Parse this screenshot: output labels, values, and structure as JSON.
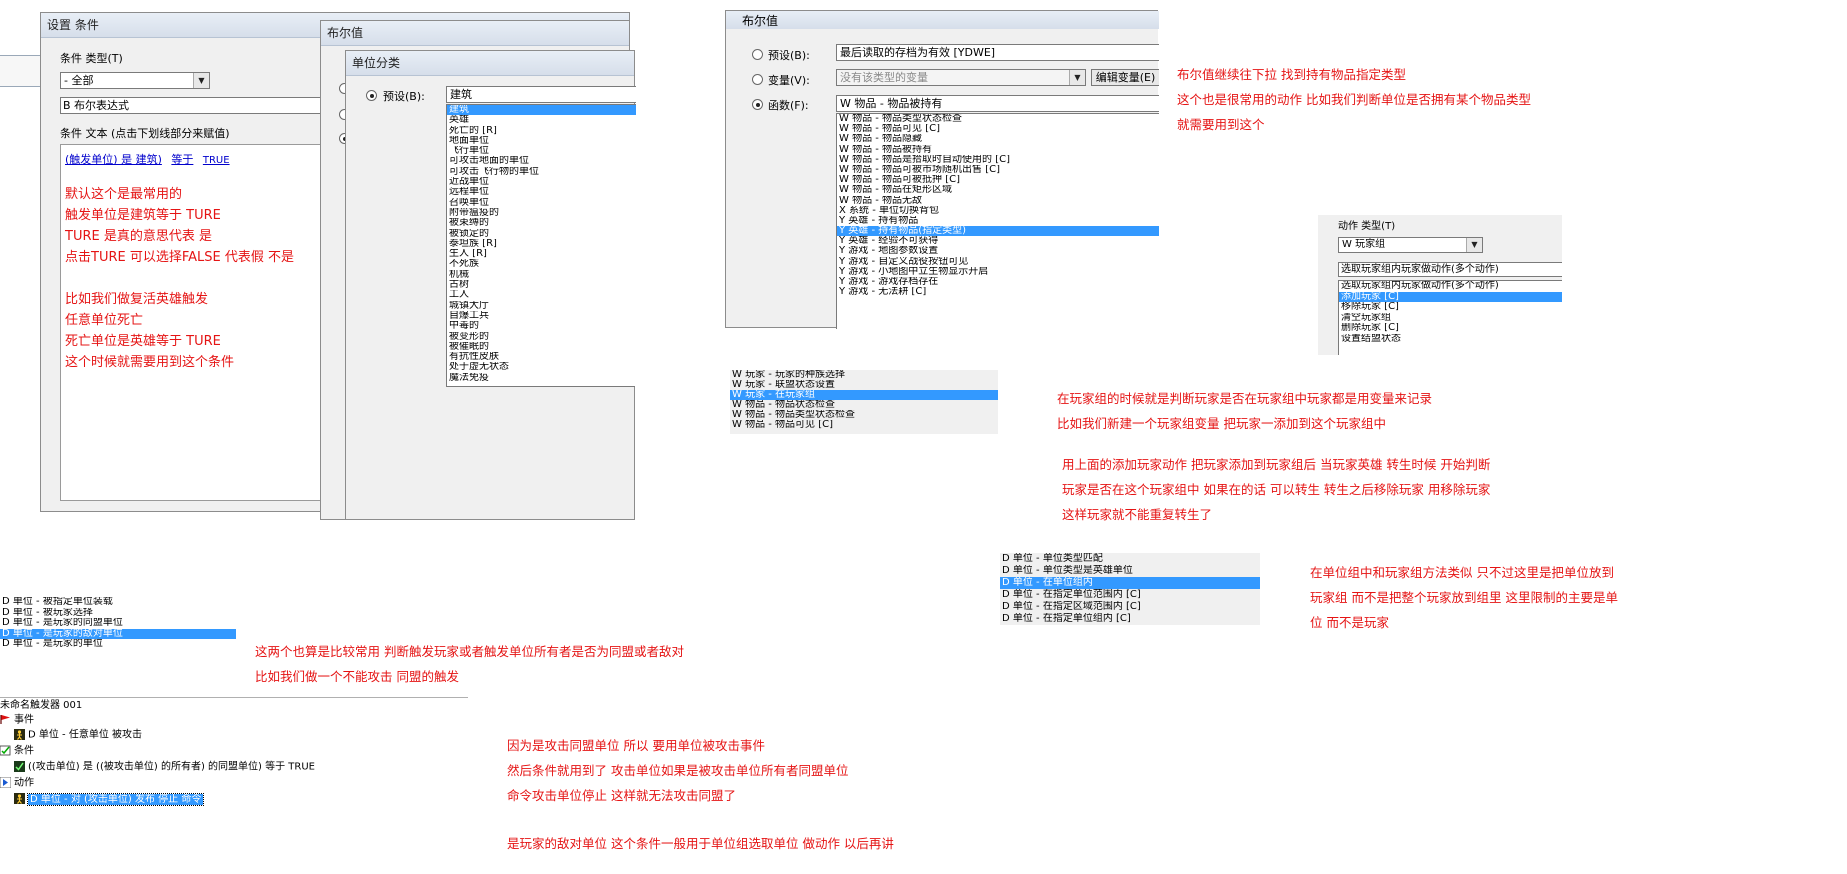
{
  "condition_dialog": {
    "title": "设置 条件",
    "type_label": "条件 类型(T)",
    "type_value": "- 全部",
    "selected_item": "B 布尔表达式",
    "text_label": "条件 文本 (点击下划线部分来赋值)",
    "expr_part1": "(触发单位) 是 建筑)",
    "expr_part2": "等于",
    "expr_part3": "TRUE"
  },
  "bool_dialog_1": {
    "title": "布尔值"
  },
  "unit_class_dialog": {
    "title": "单位分类",
    "preset_label": "预设(B):",
    "preset_value": "建筑",
    "items": [
      "建筑",
      "英雄",
      "死亡的 [R]",
      "地面单位",
      "飞行单位",
      "可攻击地面的单位",
      "可攻击飞行物的单位",
      "近战单位",
      "远程单位",
      "召唤单位",
      "附带瘟疫的",
      "被束缚的",
      "被锁定的",
      "泰坦族 [R]",
      "生人 [R]",
      "不死族",
      "机械",
      "古树",
      "工人",
      "城镇大厅",
      "自爆工兵",
      "中毒的",
      "被变形的",
      "被催眠的",
      "有抗性皮肤",
      "处于虚无状态",
      "魔法免疫"
    ],
    "selected_index": 0
  },
  "bool_dialog_2": {
    "title": "布尔值",
    "preset_label": "预设(B):",
    "preset_value": "最后读取的存档为有效 [YDWE]",
    "var_label": "变量(V):",
    "var_value": "没有该类型的变量",
    "edit_var_button": "编辑变量(E)",
    "func_label": "函数(F):",
    "func_value": "W 物品 - 物品被持有",
    "items": [
      "W 物品 - 物品类型状态检查",
      "W 物品 - 物品可见 [C]",
      "W 物品 - 物品隐藏",
      "W 物品 - 物品被持有",
      "W 物品 - 物品是拾取时自动使用的 [C]",
      "W 物品 - 物品可被市场随机出售 [C]",
      "W 物品 - 物品可被抵押 [C]",
      "W 物品 - 物品在矩形区域",
      "W 物品 - 物品无敌",
      "X 系统 - 单位切换背包",
      "Y 英雄 - 持有物品",
      "Y 英雄 - 持有物品(指定类型)",
      "Y 英雄 - 经验不可获得",
      "Y 游戏 - 地图参数设置",
      "Y 游戏 - 自定义战役按钮可见",
      "Y 游戏 - 小地图中立生物显示开启",
      "Y 游戏 - 游戏存档存在",
      "Y 游戏 - 无法耕 [C]"
    ],
    "selected_index": 11
  },
  "player_snip": {
    "items": [
      "W 玩家 - 玩家的种族选择",
      "W 玩家 - 联盟状态设置",
      "W 玩家 - 在玩家组",
      "W 物品 - 物品状态检查",
      "W 物品 - 物品类型状态检查",
      "W 物品 - 物品可见 [C]"
    ],
    "selected_index": 2
  },
  "action_snip": {
    "type_label": "动作 类型(T)",
    "type_value": "W 玩家组",
    "first_item": "选取玩家组内玩家做动作(多个动作)",
    "items": [
      "选取玩家组内玩家做动作(多个动作)",
      "添加玩家 [C]",
      "移除玩家 [C]",
      "清空玩家组",
      "删除玩家 [C]",
      "设置结盟状态"
    ],
    "selected_index": 1
  },
  "unitgroup_snip": {
    "items": [
      "D 单位 - 单位类型匹配",
      "D 单位 - 单位类型是英雄单位",
      "D 单位 - 在单位组内",
      "D 单位 - 在指定单位范围内 [C]",
      "D 单位 - 在指定区域范围内 [C]",
      "D 单位 - 在指定单位组内 [C]"
    ],
    "selected_index": 2
  },
  "ally_snip": {
    "items": [
      "D 单位 - 被指定单位装载",
      "D 单位 - 被玩家选择",
      "D 单位 - 是玩家的同盟单位",
      "D 单位 - 是玩家的敌对单位",
      "D 单位 - 是玩家的单位"
    ],
    "selected_index": 3
  },
  "trigger": {
    "name": "未命名触发器 001",
    "events_label": "事件",
    "event_item": "D 单位 - 任意单位 被攻击",
    "conditions_label": "条件",
    "condition_item": "((攻击单位) 是 ((被攻击单位) 的所有者) 的同盟单位) 等于 TRUE",
    "actions_label": "动作",
    "action_item": "D 单位 - 对 (攻击单位) 发布 停止 命令"
  },
  "notes": {
    "n1": [
      "默认这个是最常用的",
      "触发单位是建筑等于 TURE",
      "TURE 是真的意思代表 是",
      "点击TURE 可以选择FALSE 代表假 不是",
      "",
      "比如我们做复活英雄触发",
      "任意单位死亡",
      "死亡单位是英雄等于 TURE",
      "这个时候就需要用到这个条件"
    ],
    "n2": [
      "布尔值继续往下拉 找到持有物品指定类型",
      "这个也是很常用的动作 比如我们判断单位是否拥有某个物品类型",
      "就需要用到这个"
    ],
    "n3": [
      "在玩家组的时候就是判断玩家是否在玩家组中玩家都是用变量来记录",
      "比如我们新建一个玩家组变量 把玩家一添加到这个玩家组中"
    ],
    "n4": [
      "用上面的添加玩家动作   把玩家添加到玩家组后 当玩家英雄 转生时候 开始判断",
      "玩家是否在这个玩家组中 如果在的话 可以转生 转生之后移除玩家 用移除玩家",
      "这样玩家就不能重复转生了"
    ],
    "n5": [
      "在单位组中和玩家组方法类似 只不过这里是把单位放到",
      "玩家组 而不是把整个玩家放到组里 这里限制的主要是单",
      "位 而不是玩家"
    ],
    "n6": [
      "这两个也算是比较常用 判断触发玩家或者触发单位所有者是否为同盟或者敌对",
      "比如我们做一个不能攻击 同盟的触发"
    ],
    "n7": [
      "因为是攻击同盟单位 所以 要用单位被攻击事件",
      "然后条件就用到了 攻击单位如果是被攻击单位所有者同盟单位",
      "命令攻击单位停止 这样就无法攻击同盟了"
    ],
    "n8": "是玩家的敌对单位 这个条件一般用于单位组选取单位 做动作 以后再讲"
  }
}
